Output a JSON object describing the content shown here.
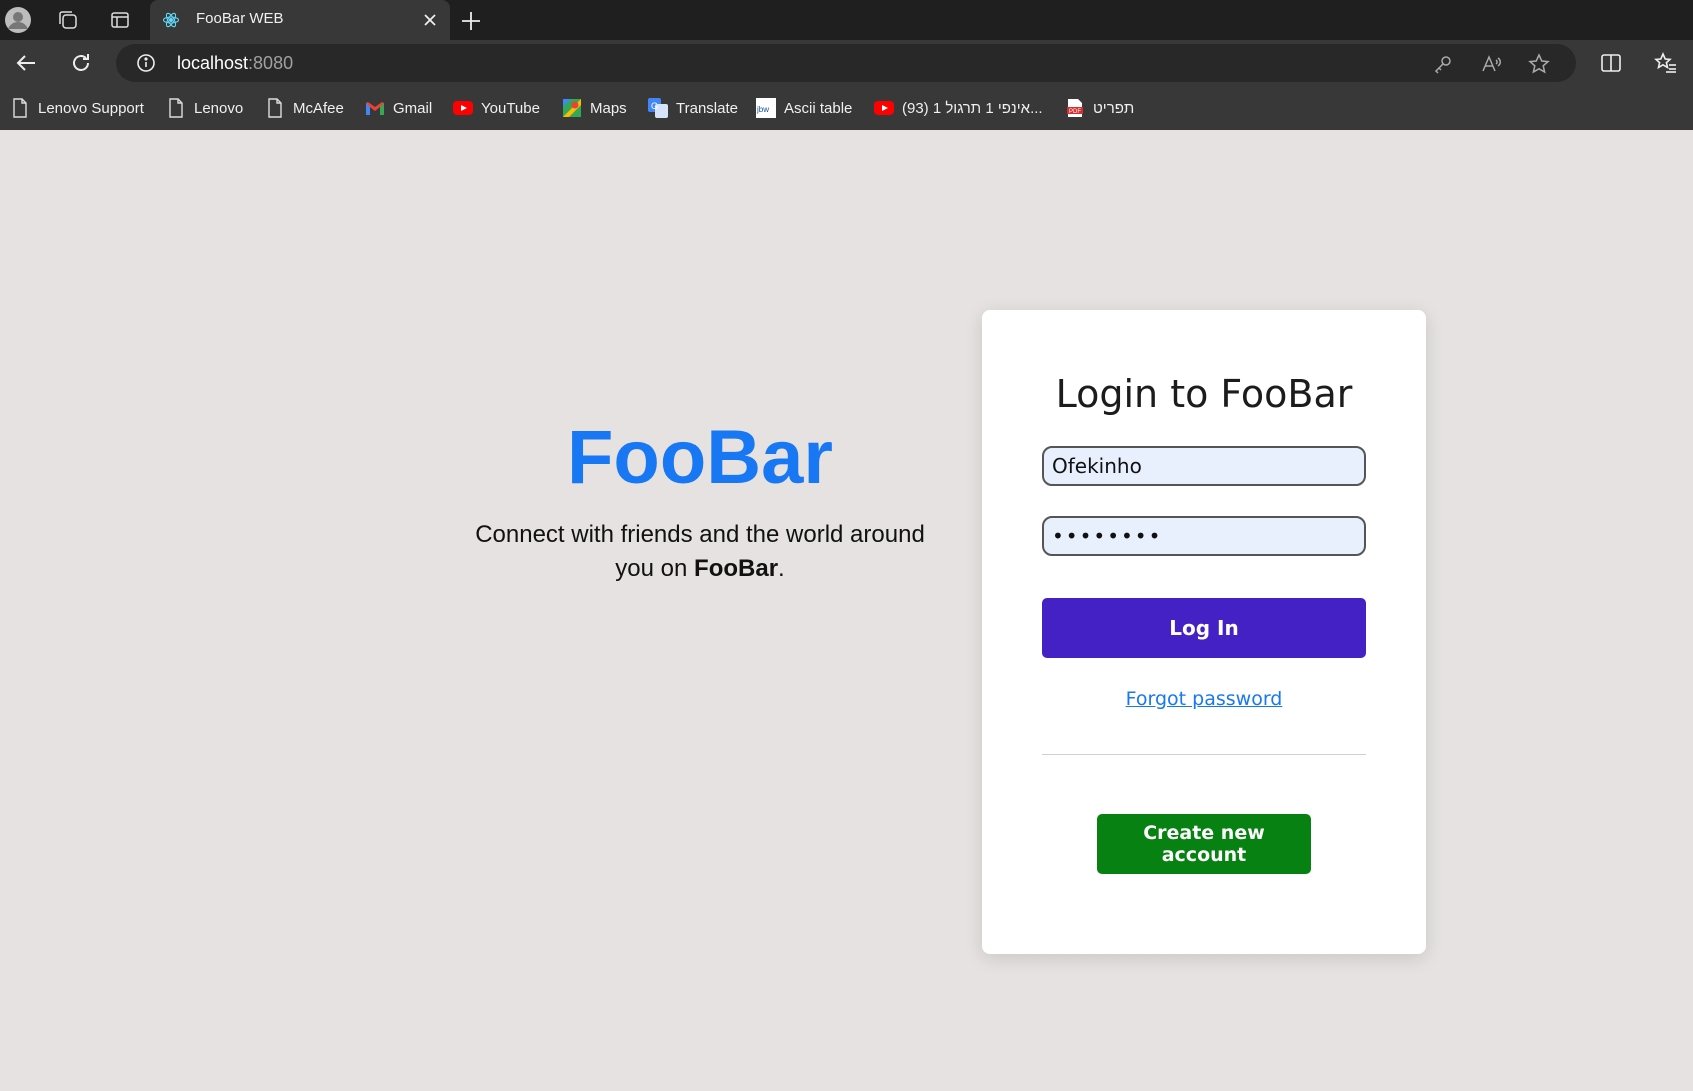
{
  "browser": {
    "tab": {
      "title": "FooBar WEB",
      "favicon": "react-icon"
    },
    "address": {
      "host": "localhost",
      "port": ":8080"
    },
    "bookmarks": [
      {
        "label": "Lenovo Support",
        "icon": "page-icon"
      },
      {
        "label": "Lenovo",
        "icon": "page-icon"
      },
      {
        "label": "McAfee",
        "icon": "page-icon"
      },
      {
        "label": "Gmail",
        "icon": "gmail-icon"
      },
      {
        "label": "YouTube",
        "icon": "youtube-icon"
      },
      {
        "label": "Maps",
        "icon": "maps-icon"
      },
      {
        "label": "Translate",
        "icon": "translate-icon"
      },
      {
        "label": "Ascii table",
        "icon": "jbw-icon"
      },
      {
        "label": "(93) אינפי 1 תרגול 1...",
        "icon": "youtube-icon"
      },
      {
        "label": "תפריט",
        "icon": "pdf-icon"
      }
    ]
  },
  "brand": {
    "title": "FooBar",
    "tagline": "Connect with friends and the world around you on",
    "tagline_bold": "FooBar",
    "tagline_end": "."
  },
  "login": {
    "title": "Login to FooBar",
    "username_value": "Ofekinho",
    "password_value": "••••••••",
    "login_label": "Log In",
    "forgot_label": "Forgot password",
    "create_label": "Create new account"
  },
  "colors": {
    "brand": "#1877f2",
    "login_button": "#4421c5",
    "create_button": "#078111",
    "page_bg": "#e5e2e1"
  }
}
